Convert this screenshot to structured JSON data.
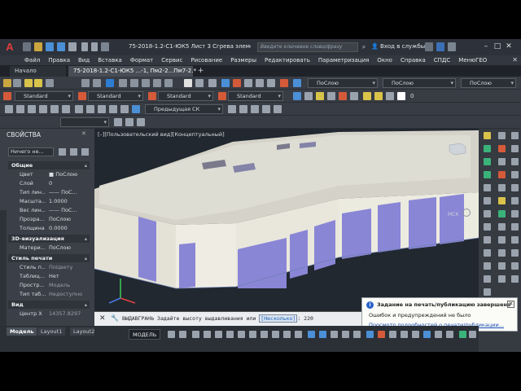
{
  "app": {
    "logo_text": "A",
    "doc_title": "75-2018-1.2-С1-ЮК5 Лист 3 Сгрева элемент",
    "search_placeholder": "Введите ключевое слово/фразу",
    "signin_label": "Вход в службы",
    "window_buttons": [
      "–",
      "□",
      "✕"
    ]
  },
  "menu": {
    "items": [
      "Файл",
      "Правка",
      "Вид",
      "Вставка",
      "Формат",
      "Сервис",
      "Рисование",
      "Размеры",
      "Редактировать",
      "Параметризация",
      "Окно",
      "Справка",
      "СПДС",
      "МенюГЕО"
    ],
    "close_glyph": "✕"
  },
  "tabs": {
    "start": "Начало",
    "document": "75-2018-1.2-С1-ЮК5 ...-1, Пм2-2...Пм7-2.*",
    "add": "+"
  },
  "toolbar1": {
    "layer1": "ПоСлою",
    "layer2": "ПоСлою",
    "layer3": "ПоСлою"
  },
  "toolbar2": {
    "style1": "Standard",
    "style2": "Standard",
    "style3": "Standard",
    "style4": "Standard",
    "layer_value": "0"
  },
  "toolbar3": {
    "ucs": "Предыдущая СК"
  },
  "properties": {
    "title": "СВОЙСТВА",
    "selection": "Ничего не...",
    "sections": {
      "general": "Общие",
      "viz3d": "3D-визуализация",
      "plot": "Стиль печати",
      "view": "Вид"
    },
    "general_rows": [
      {
        "k": "Цвет",
        "v": "■ ПоСлою"
      },
      {
        "k": "Слой",
        "v": "0"
      },
      {
        "k": "Тип лин...",
        "v": "—— ПоС..."
      },
      {
        "k": "Масшта...",
        "v": "1.0000"
      },
      {
        "k": "Вес лин...",
        "v": "—— ПоС..."
      },
      {
        "k": "Прозра...",
        "v": "ПоСлою"
      },
      {
        "k": "Толщина",
        "v": "0.0000"
      }
    ],
    "viz_rows": [
      {
        "k": "Матери...",
        "v": "ПоСлою"
      }
    ],
    "plot_rows": [
      {
        "k": "Стиль п...",
        "v": "ПоЦвету"
      },
      {
        "k": "Таблиц...",
        "v": "Нет"
      },
      {
        "k": "Простр...",
        "v": "Модель"
      },
      {
        "k": "Тип таб...",
        "v": "Недоступно"
      }
    ],
    "view_rows": [
      {
        "k": "Центр X",
        "v": "14357.8297"
      }
    ]
  },
  "viewport": {
    "label": "[–][Пользовательский вид][Концептуальный]",
    "wcs_label": "МСК"
  },
  "command": {
    "text": "ВЫДАВГРАНЬ Задайте высоту выдавливания или",
    "option": "[Несколько]",
    "value": ": 220"
  },
  "notification": {
    "title": "Задание на печать/публикацию завершено",
    "message": "Ошибок и предупреждений не было",
    "link": "Просмотр подробностей о печати/публикации..."
  },
  "layout_tabs": {
    "model": "Модель",
    "layout1": "Layout1",
    "layout2": "Layout2",
    "add": "+"
  },
  "status": {
    "model": "МОДЕЛЬ"
  },
  "colors": {
    "accent_red": "#e23c3c",
    "building_face": "#e9e7dc",
    "window_blue": "#8a86d6",
    "viewport_bg": "#212830",
    "info_blue": "#2a62c9"
  }
}
